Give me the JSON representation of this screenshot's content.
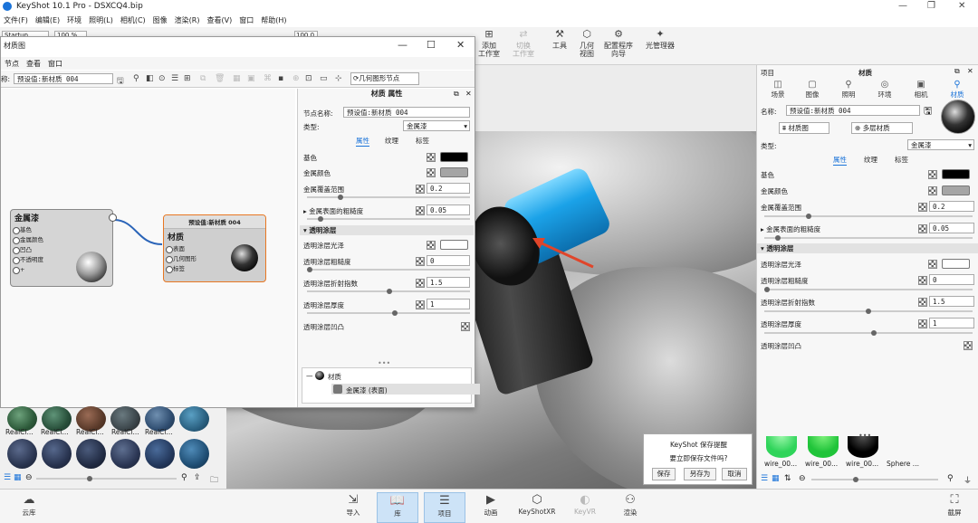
{
  "app": {
    "title": "KeyShot 10.1 Pro  -  DSXCQ4.bip"
  },
  "menu": [
    "文件(F)",
    "编辑(E)",
    "环境",
    "照明(L)",
    "相机(C)",
    "图像",
    "渲染(R)",
    "查看(V)",
    "窗口",
    "帮助(H)"
  ],
  "ribbon": {
    "workspace": "Startup",
    "zoom": "100 %",
    "fps": "100.0",
    "tools": [
      {
        "label": "添加\n工作室",
        "icon": "add-studio-icon"
      },
      {
        "label": "切换\n工作室",
        "icon": "switch-studio-icon",
        "disabled": true
      },
      {
        "label": "工具",
        "icon": "tools-icon"
      },
      {
        "label": "几何\n视图",
        "icon": "geometry-view-icon"
      },
      {
        "label": "配置程序\n向导",
        "icon": "configurator-wizard-icon"
      },
      {
        "label": "光管理器",
        "icon": "light-manager-icon"
      }
    ]
  },
  "material_window": {
    "title": "材质图",
    "menu": [
      "节点",
      "查看",
      "窗口"
    ],
    "name_prefix": "称:",
    "name_value": "预设值:新材质 004",
    "geometry_node_button": "几何图形节点",
    "node_metal": {
      "title": "金属漆",
      "ports": [
        "基色",
        "金属颜色",
        "凹凸",
        "不透明度",
        "+"
      ]
    },
    "node_material": {
      "header": "预设值:新材质 004",
      "title": "材质",
      "ports": [
        "表面",
        "几何图形",
        "标签"
      ]
    },
    "props": {
      "header": "材质 属性",
      "node_name_label": "节点名称:",
      "node_name_value": "预设值:新材质 004",
      "type_label": "类型:",
      "type_value": "金属漆",
      "tabs": [
        "属性",
        "纹理",
        "标签"
      ],
      "base_color": "基色",
      "metal_color": "金属颜色",
      "metal_coverage": "金属覆盖范围",
      "metal_coverage_value": "0.2",
      "metal_roughness": "金属表面的粗糙度",
      "metal_roughness_value": "0.05",
      "clearcoat_section": "透明涂层",
      "clearcoat_gloss": "透明涂层光泽",
      "clearcoat_roughness": "透明涂层粗糙度",
      "clearcoat_roughness_value": "0",
      "clearcoat_ior": "透明涂层折射指数",
      "clearcoat_ior_value": "1.5",
      "clearcoat_thickness": "透明涂层厚度",
      "clearcoat_thickness_value": "1",
      "clearcoat_bump": "透明涂层凹凸",
      "tree_material": "材质",
      "tree_child": "金属漆 (表面)"
    }
  },
  "library": {
    "captions": [
      "RealCl...",
      "RealCl...",
      "RealCl...",
      "RealCl...",
      "RealCl..."
    ]
  },
  "right_panel": {
    "tab_project": "项目",
    "tab_material": "材质",
    "tabs": [
      "场景",
      "图像",
      "照明",
      "环境",
      "相机",
      "材质"
    ],
    "name_label": "名称:",
    "name_value": "预设值:新材质 004",
    "material_graph_button": "材质图",
    "multi_material_button": "多层材质",
    "type_label": "类型:",
    "type_value": "金属漆",
    "subtabs": [
      "属性",
      "纹理",
      "标签"
    ],
    "base_color": "基色",
    "metal_color": "金属颜色",
    "metal_coverage": "金属覆盖范围",
    "metal_coverage_value": "0.2",
    "metal_roughness": "金属表面的粗糙度",
    "metal_roughness_value": "0.05",
    "clearcoat_section": "透明涂层",
    "clearcoat_gloss": "透明涂层光泽",
    "clearcoat_roughness": "透明涂层粗糙度",
    "clearcoat_roughness_value": "0",
    "clearcoat_ior": "透明涂层折射指数",
    "clearcoat_ior_value": "1.5",
    "clearcoat_thickness": "透明涂层厚度",
    "clearcoat_thickness_value": "1",
    "clearcoat_bump": "透明涂层凹凸",
    "thumbs": [
      "wire_00...",
      "wire_00...",
      "wire_00...",
      "Sphere ..."
    ]
  },
  "save_dialog": {
    "title": "KeyShot 保存提醒",
    "message": "要立即保存文件吗?",
    "save": "保存",
    "save_as": "另存为",
    "cancel": "取消"
  },
  "bottom": {
    "cloud": "云库",
    "import": "导入",
    "library": "库",
    "project": "项目",
    "animation": "动画",
    "keyshotxr": "KeyShotXR",
    "keyvr": "KeyVR",
    "render": "渲染",
    "screenshot": "截屏"
  },
  "colors": {
    "accent": "#1a73d9",
    "selected_node": "#e87722",
    "arrow": "#e0452a"
  }
}
